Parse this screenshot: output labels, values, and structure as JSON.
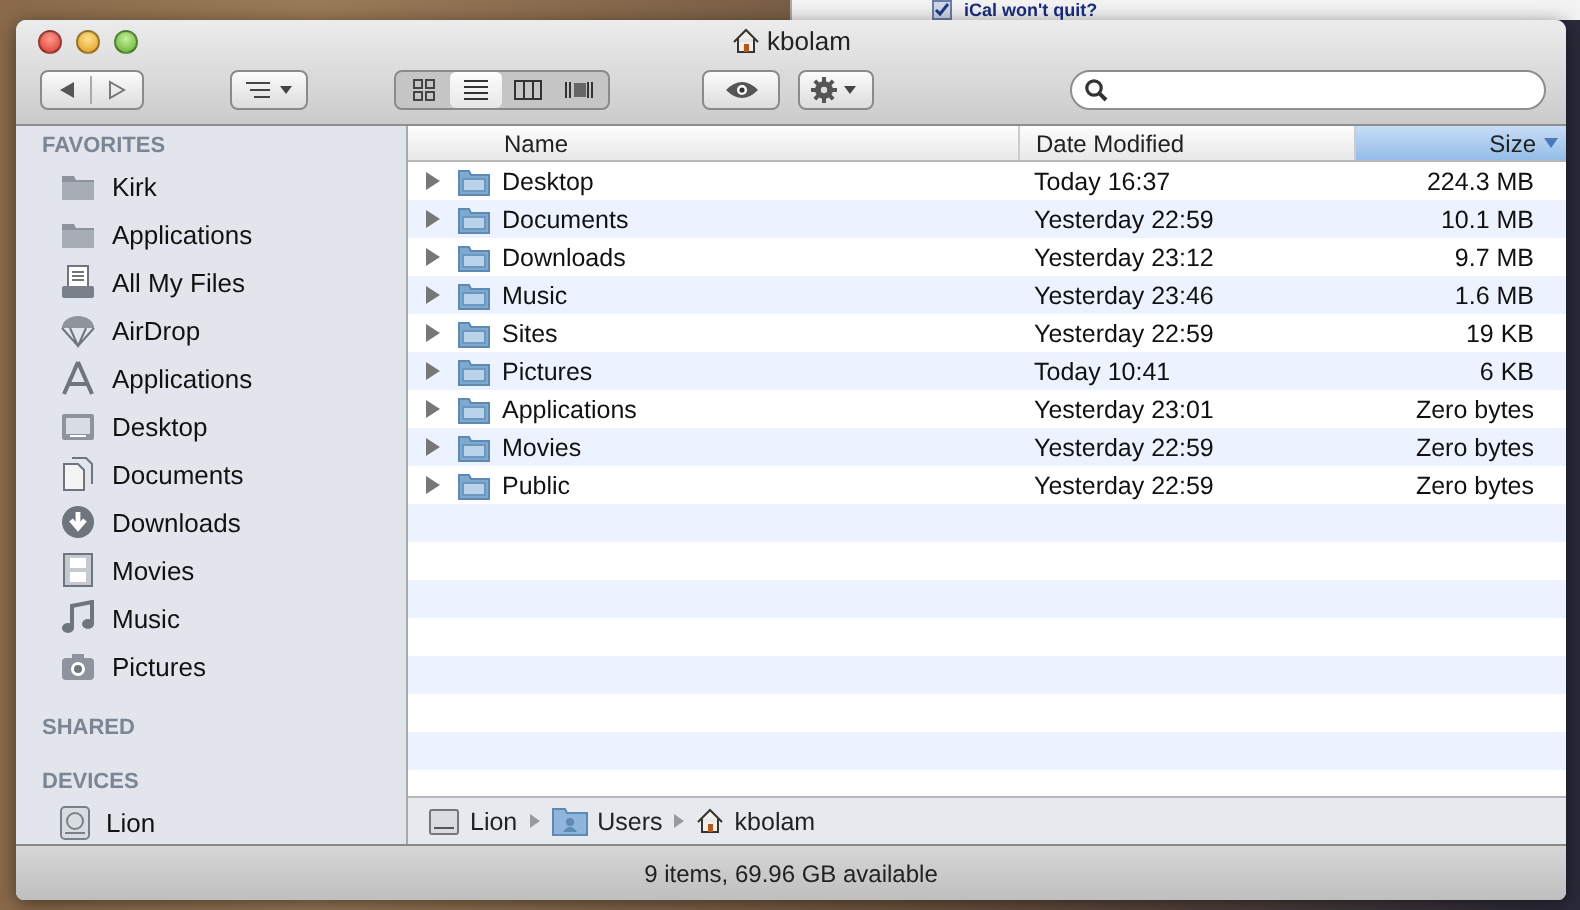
{
  "background_window": {
    "heading": "iCal won't quit?"
  },
  "window": {
    "title": "kbolam"
  },
  "toolbar": {
    "view_buttons": [
      {
        "selected": false
      },
      {
        "selected": true
      },
      {
        "selected": false
      },
      {
        "selected": false
      }
    ]
  },
  "sidebar": {
    "sections": [
      {
        "title": "FAVORITES",
        "items": [
          {
            "label": "Kirk"
          },
          {
            "label": "Applications"
          },
          {
            "label": "All My Files"
          },
          {
            "label": "AirDrop"
          },
          {
            "label": "Applications"
          },
          {
            "label": "Desktop"
          },
          {
            "label": "Documents"
          },
          {
            "label": "Downloads"
          },
          {
            "label": "Movies"
          },
          {
            "label": "Music"
          },
          {
            "label": "Pictures"
          }
        ]
      },
      {
        "title": "SHARED"
      },
      {
        "title": "DEVICES",
        "items": [
          {
            "label": "Lion"
          }
        ]
      }
    ]
  },
  "table": {
    "columns": [
      {
        "label": "Name",
        "selected": false
      },
      {
        "label": "Date Modified",
        "selected": false
      },
      {
        "label": "Size",
        "selected": true
      }
    ],
    "rows": [
      {
        "name": "Desktop",
        "date": "Today 16:37",
        "size": "224.3 MB"
      },
      {
        "name": "Documents",
        "date": "Yesterday 22:59",
        "size": "10.1 MB"
      },
      {
        "name": "Downloads",
        "date": "Yesterday 23:12",
        "size": "9.7 MB"
      },
      {
        "name": "Music",
        "date": "Yesterday 23:46",
        "size": "1.6 MB"
      },
      {
        "name": "Sites",
        "date": "Yesterday 22:59",
        "size": "19 KB"
      },
      {
        "name": "Pictures",
        "date": "Today 10:41",
        "size": "6 KB"
      },
      {
        "name": "Applications",
        "date": "Yesterday 23:01",
        "size": "Zero bytes"
      },
      {
        "name": "Movies",
        "date": "Yesterday 22:59",
        "size": "Zero bytes"
      },
      {
        "name": "Public",
        "date": "Yesterday 22:59",
        "size": "Zero bytes"
      }
    ]
  },
  "path_bar": [
    {
      "label": "Lion"
    },
    {
      "label": "Users"
    },
    {
      "label": "kbolam"
    }
  ],
  "status_bar": "9 items, 69.96 GB available"
}
